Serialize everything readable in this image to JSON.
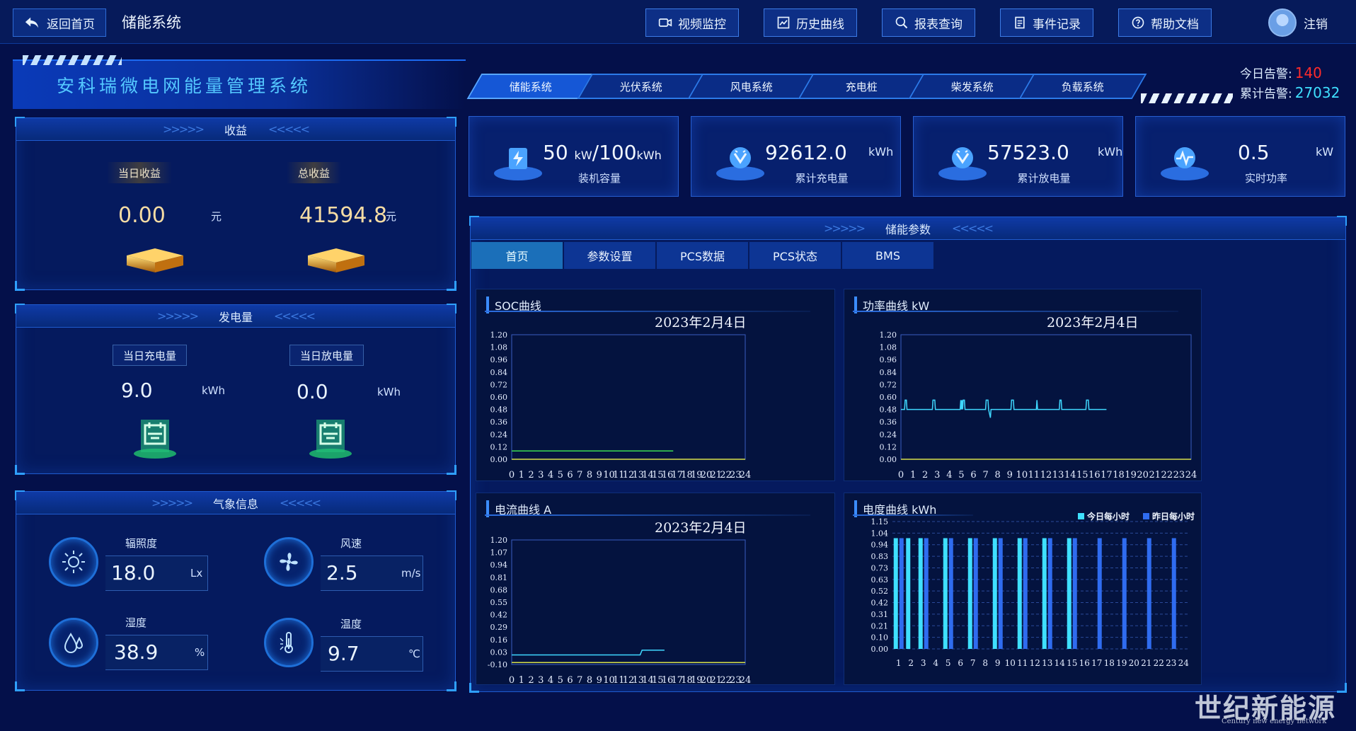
{
  "topbar": {
    "back_label": "返回首页",
    "system_title": "储能系统",
    "tabs": [
      "视频监控",
      "历史曲线",
      "报表查询",
      "事件记录",
      "帮助文档"
    ],
    "logout_label": "注销"
  },
  "header": {
    "title": "安科瑞微电网能量管理系统",
    "systems": [
      "储能系统",
      "光伏系统",
      "风电系统",
      "充电桩",
      "柴发系统",
      "负载系统"
    ],
    "alarm_today_label": "今日告警:",
    "alarm_today_value": "140",
    "alarm_total_label": "累计告警:",
    "alarm_total_value": "27032"
  },
  "income": {
    "title": "收益",
    "today_label": "当日收益",
    "today_value": "0.00",
    "today_unit": "元",
    "total_label": "总收益",
    "total_value": "41594.8",
    "total_unit": "元"
  },
  "generation": {
    "title": "发电量",
    "charge_label": "当日充电量",
    "charge_value": "9.0",
    "charge_unit": "kWh",
    "discharge_label": "当日放电量",
    "discharge_value": "0.0",
    "discharge_unit": "kWh"
  },
  "weather": {
    "title": "气象信息",
    "irradiance_label": "辐照度",
    "irradiance_value": "18.0",
    "irradiance_unit": "Lx",
    "wind_label": "风速",
    "wind_value": "2.5",
    "wind_unit": "m/s",
    "humidity_label": "湿度",
    "humidity_value": "38.9",
    "humidity_unit": "%",
    "temp_label": "温度",
    "temp_value": "9.7",
    "temp_unit": "℃"
  },
  "kpis": {
    "capacity_power": "50",
    "capacity_power_unit": "kW",
    "capacity_sep": "/",
    "capacity_energy": "100",
    "capacity_energy_unit": "kWh",
    "capacity_label": "装机容量",
    "charged_value": "92612.0",
    "charged_unit": "kWh",
    "charged_label": "累计充电量",
    "discharged_value": "57523.0",
    "discharged_unit": "kWh",
    "discharged_label": "累计放电量",
    "power_value": "0.5",
    "power_unit": "kW",
    "power_label": "实时功率"
  },
  "storage": {
    "title": "储能参数",
    "tabs": [
      "首页",
      "参数设置",
      "PCS数据",
      "PCS状态",
      "BMS"
    ]
  },
  "watermark": {
    "main": "世纪新能源网",
    "sub": "Century new energy network"
  },
  "colors": {
    "accent": "#3b8cff",
    "alarm_today": "#ff2b2b",
    "alarm_total": "#3fe0ff",
    "today_bar": "#3fe0ff",
    "yesterday_bar": "#2f6cf0"
  },
  "chart_data": [
    {
      "type": "line",
      "title": "SOC曲线",
      "date_label": "2023年2月4日",
      "ylim": [
        0,
        1.2
      ],
      "yticks": [
        "1.20",
        "1.08",
        "0.96",
        "0.84",
        "0.72",
        "0.60",
        "0.48",
        "0.36",
        "0.24",
        "0.12",
        "0.00"
      ],
      "xticks": [
        "0",
        "1",
        "2",
        "3",
        "4",
        "5",
        "6",
        "7",
        "8",
        "9",
        "10",
        "11",
        "12",
        "13",
        "14",
        "15",
        "16",
        "17",
        "18",
        "19",
        "20",
        "21",
        "22",
        "23",
        "24"
      ],
      "series": [
        {
          "color": "#3ddc52",
          "x": [
            0,
            16.6
          ],
          "y": [
            0.08,
            0.08
          ]
        },
        {
          "color": "#d8e04a",
          "x": [
            0,
            24
          ],
          "y": [
            0.0,
            0.0
          ]
        }
      ]
    },
    {
      "type": "line",
      "title": "功率曲线",
      "unit": "kW",
      "date_label": "2023年2月4日",
      "ylim": [
        0,
        1.2
      ],
      "yticks": [
        "1.20",
        "1.08",
        "0.96",
        "0.84",
        "0.72",
        "0.60",
        "0.48",
        "0.36",
        "0.24",
        "0.12",
        "0.00"
      ],
      "xticks": [
        "0",
        "1",
        "2",
        "3",
        "4",
        "5",
        "6",
        "7",
        "8",
        "9",
        "10",
        "11",
        "12",
        "13",
        "14",
        "15",
        "16",
        "17",
        "18",
        "19",
        "20",
        "21",
        "22",
        "23",
        "24"
      ],
      "series": [
        {
          "color": "#3fd8ff",
          "x": [
            0,
            0.3,
            0.35,
            0.45,
            0.5,
            2.6,
            2.65,
            2.8,
            2.85,
            4.9,
            4.95,
            5.0,
            5.05,
            5.1,
            5.15,
            5.25,
            5.3,
            7.0,
            7.05,
            7.2,
            7.25,
            7.4,
            7.45,
            7.5,
            9.1,
            9.15,
            9.3,
            9.35,
            11.2,
            11.25,
            11.3,
            11.35,
            13.1,
            13.15,
            13.25,
            13.3,
            15.3,
            15.35,
            15.5,
            15.55,
            17.0
          ],
          "y": [
            0.48,
            0.48,
            0.57,
            0.57,
            0.48,
            0.48,
            0.57,
            0.57,
            0.48,
            0.48,
            0.57,
            0.48,
            0.57,
            0.48,
            0.57,
            0.57,
            0.48,
            0.48,
            0.57,
            0.57,
            0.48,
            0.4,
            0.48,
            0.48,
            0.48,
            0.57,
            0.57,
            0.48,
            0.48,
            0.57,
            0.48,
            0.48,
            0.48,
            0.57,
            0.57,
            0.48,
            0.48,
            0.57,
            0.57,
            0.48,
            0.48
          ]
        },
        {
          "color": "#d8e04a",
          "x": [
            0,
            24
          ],
          "y": [
            0.0,
            0.0
          ]
        }
      ]
    },
    {
      "type": "line",
      "title": "电流曲线",
      "unit": "A",
      "date_label": "2023年2月4日",
      "ylim": [
        -0.1,
        1.2
      ],
      "yticks": [
        "1.20",
        "1.07",
        "0.94",
        "0.81",
        "0.68",
        "0.55",
        "0.42",
        "0.29",
        "0.16",
        "0.03",
        "-0.10"
      ],
      "xticks": [
        "0",
        "1",
        "2",
        "3",
        "4",
        "5",
        "6",
        "7",
        "8",
        "9",
        "10",
        "11",
        "12",
        "13",
        "14",
        "15",
        "16",
        "17",
        "18",
        "19",
        "20",
        "21",
        "22",
        "23",
        "24"
      ],
      "series": [
        {
          "color": "#3fd8ff",
          "x": [
            0,
            13.2,
            13.4,
            15.7
          ],
          "y": [
            0.0,
            0.0,
            0.05,
            0.05
          ]
        },
        {
          "color": "#d8e04a",
          "x": [
            0,
            24
          ],
          "y": [
            -0.08,
            -0.08
          ]
        }
      ]
    },
    {
      "type": "bar",
      "title": "电度曲线",
      "unit": "kWh",
      "ylim": [
        0,
        1.15
      ],
      "yticks": [
        "1.15",
        "1.04",
        "0.94",
        "0.83",
        "0.73",
        "0.63",
        "0.52",
        "0.42",
        "0.31",
        "0.21",
        "0.10",
        "0.00"
      ],
      "categories": [
        "1",
        "2",
        "3",
        "4",
        "5",
        "6",
        "7",
        "8",
        "9",
        "10",
        "11",
        "12",
        "13",
        "14",
        "15",
        "16",
        "17",
        "18",
        "19",
        "20",
        "21",
        "22",
        "23",
        "24"
      ],
      "series": [
        {
          "name": "今日每小时",
          "color": "#3fe0ff",
          "values": [
            1.0,
            1.0,
            1.0,
            0,
            1.0,
            0,
            1.0,
            0,
            1.0,
            0,
            1.0,
            0,
            1.0,
            0,
            1.0,
            0,
            0,
            0,
            0,
            0,
            0,
            0,
            0,
            0
          ]
        },
        {
          "name": "昨日每小时",
          "color": "#2f6cf0",
          "values": [
            1.0,
            0,
            1.0,
            0,
            1.0,
            0,
            1.0,
            0,
            1.0,
            0,
            1.0,
            0,
            1.0,
            0,
            1.0,
            0,
            1.0,
            0,
            1.0,
            0,
            1.0,
            0,
            1.0,
            0
          ]
        }
      ]
    }
  ]
}
